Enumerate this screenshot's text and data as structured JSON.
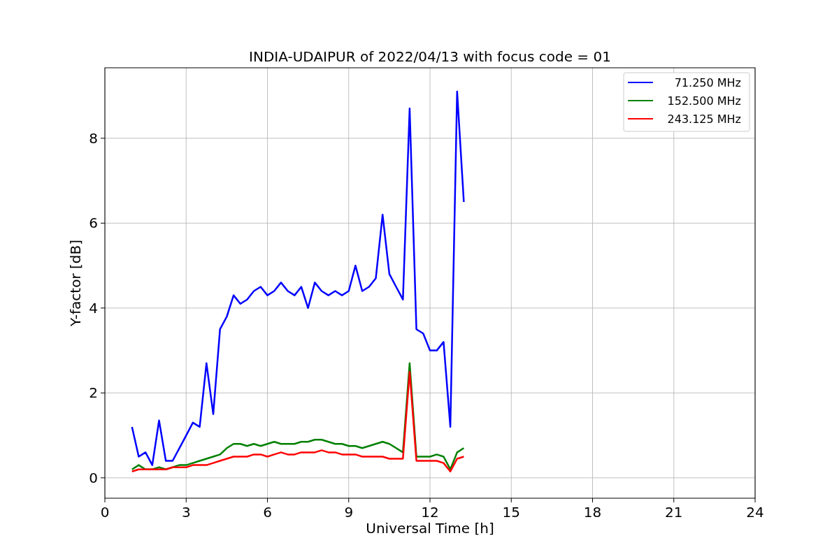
{
  "figure": {
    "chart_data": {
      "type": "line",
      "title": "INDIA-UDAIPUR of 2022/04/13 with focus code = 01",
      "xlabel": "Universal Time [h]",
      "ylabel": "Y-factor [dB]",
      "x": [
        1,
        1.25,
        1.5,
        1.75,
        2,
        2.25,
        2.5,
        2.75,
        3,
        3.25,
        3.5,
        3.75,
        4,
        4.25,
        4.5,
        4.75,
        5,
        5.25,
        5.5,
        5.75,
        6,
        6.25,
        6.5,
        6.75,
        7,
        7.25,
        7.5,
        7.75,
        8,
        8.25,
        8.5,
        8.75,
        9,
        9.25,
        9.5,
        9.75,
        10,
        10.25,
        10.5,
        10.75,
        11,
        11.25,
        11.5,
        11.75,
        12,
        12.25,
        12.5,
        12.75,
        13,
        13.25
      ],
      "series": [
        {
          "name": "71.250 MHz",
          "color": "#0000ff",
          "values": [
            1.2,
            0.5,
            0.6,
            0.3,
            1.35,
            0.4,
            0.4,
            0.7,
            1.0,
            1.3,
            1.2,
            2.7,
            1.5,
            3.5,
            3.8,
            4.3,
            4.1,
            4.2,
            4.4,
            4.5,
            4.3,
            4.4,
            4.6,
            4.4,
            4.3,
            4.5,
            4.0,
            4.6,
            4.4,
            4.3,
            4.4,
            4.3,
            4.4,
            5.0,
            4.4,
            4.5,
            4.7,
            6.2,
            4.8,
            4.5,
            4.2,
            8.7,
            3.5,
            3.4,
            3.0,
            3.0,
            3.2,
            1.2,
            9.1,
            6.5
          ]
        },
        {
          "name": "152.500 MHz",
          "color": "#008000",
          "values": [
            0.2,
            0.3,
            0.2,
            0.2,
            0.25,
            0.2,
            0.25,
            0.3,
            0.3,
            0.35,
            0.4,
            0.45,
            0.5,
            0.55,
            0.7,
            0.8,
            0.8,
            0.75,
            0.8,
            0.75,
            0.8,
            0.85,
            0.8,
            0.8,
            0.8,
            0.85,
            0.85,
            0.9,
            0.9,
            0.85,
            0.8,
            0.8,
            0.75,
            0.75,
            0.7,
            0.75,
            0.8,
            0.85,
            0.8,
            0.7,
            0.6,
            2.7,
            0.5,
            0.5,
            0.5,
            0.55,
            0.5,
            0.2,
            0.6,
            0.7
          ]
        },
        {
          "name": "243.125 MHz",
          "color": "#ff0000",
          "values": [
            0.15,
            0.2,
            0.2,
            0.2,
            0.2,
            0.2,
            0.25,
            0.25,
            0.25,
            0.3,
            0.3,
            0.3,
            0.35,
            0.4,
            0.45,
            0.5,
            0.5,
            0.5,
            0.55,
            0.55,
            0.5,
            0.55,
            0.6,
            0.55,
            0.55,
            0.6,
            0.6,
            0.6,
            0.65,
            0.6,
            0.6,
            0.55,
            0.55,
            0.55,
            0.5,
            0.5,
            0.5,
            0.5,
            0.45,
            0.45,
            0.45,
            2.5,
            0.4,
            0.4,
            0.4,
            0.4,
            0.35,
            0.15,
            0.45,
            0.5
          ]
        }
      ],
      "grid": true,
      "legend": true,
      "xlim": [
        0,
        24
      ],
      "ylim": [
        -0.48,
        9.66
      ],
      "xticks": [
        0,
        3,
        6,
        9,
        12,
        15,
        18,
        21,
        24
      ],
      "yticks": [
        0,
        2,
        4,
        6,
        8
      ]
    }
  }
}
